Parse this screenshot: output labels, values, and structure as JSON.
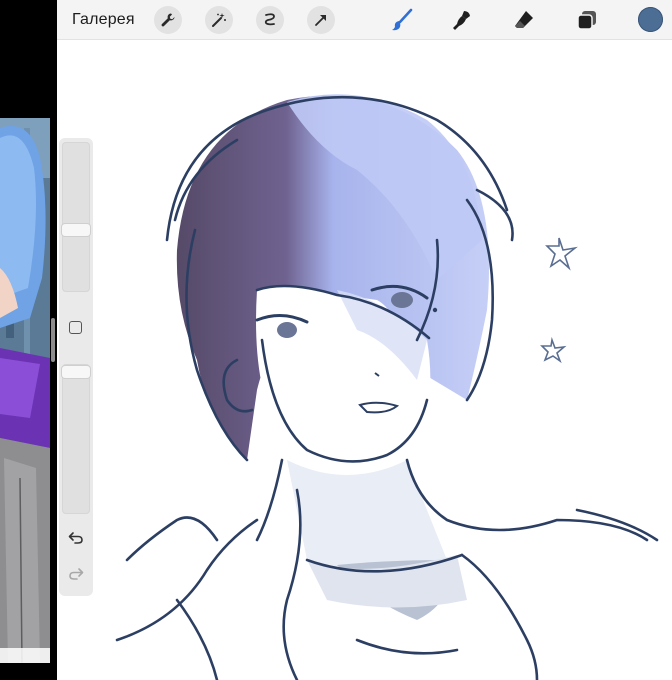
{
  "toolbar": {
    "gallery_label": "Галерея",
    "left_tools": [
      {
        "name": "wrench-icon"
      },
      {
        "name": "magic-wand-icon"
      },
      {
        "name": "selection-icon"
      },
      {
        "name": "transform-arrow-icon"
      }
    ],
    "right_tools": [
      {
        "name": "brush-icon",
        "active": true
      },
      {
        "name": "smudge-icon"
      },
      {
        "name": "eraser-icon"
      },
      {
        "name": "layers-icon"
      }
    ],
    "current_color": "#4d6e94"
  },
  "sidebar": {
    "size_slider": "brush-size-slider",
    "opacity_slider": "brush-opacity-slider",
    "modify_button": "modify-square-button",
    "undo": "undo-arrow-icon",
    "redo": "redo-arrow-icon"
  },
  "colors": {
    "accent": "#2f6fd6",
    "toolbar_bg": "#f4f4f4",
    "line_art": "#2c3f63",
    "hair_light": "#b9c4ef",
    "hair_dark": "#5b4f6c"
  }
}
